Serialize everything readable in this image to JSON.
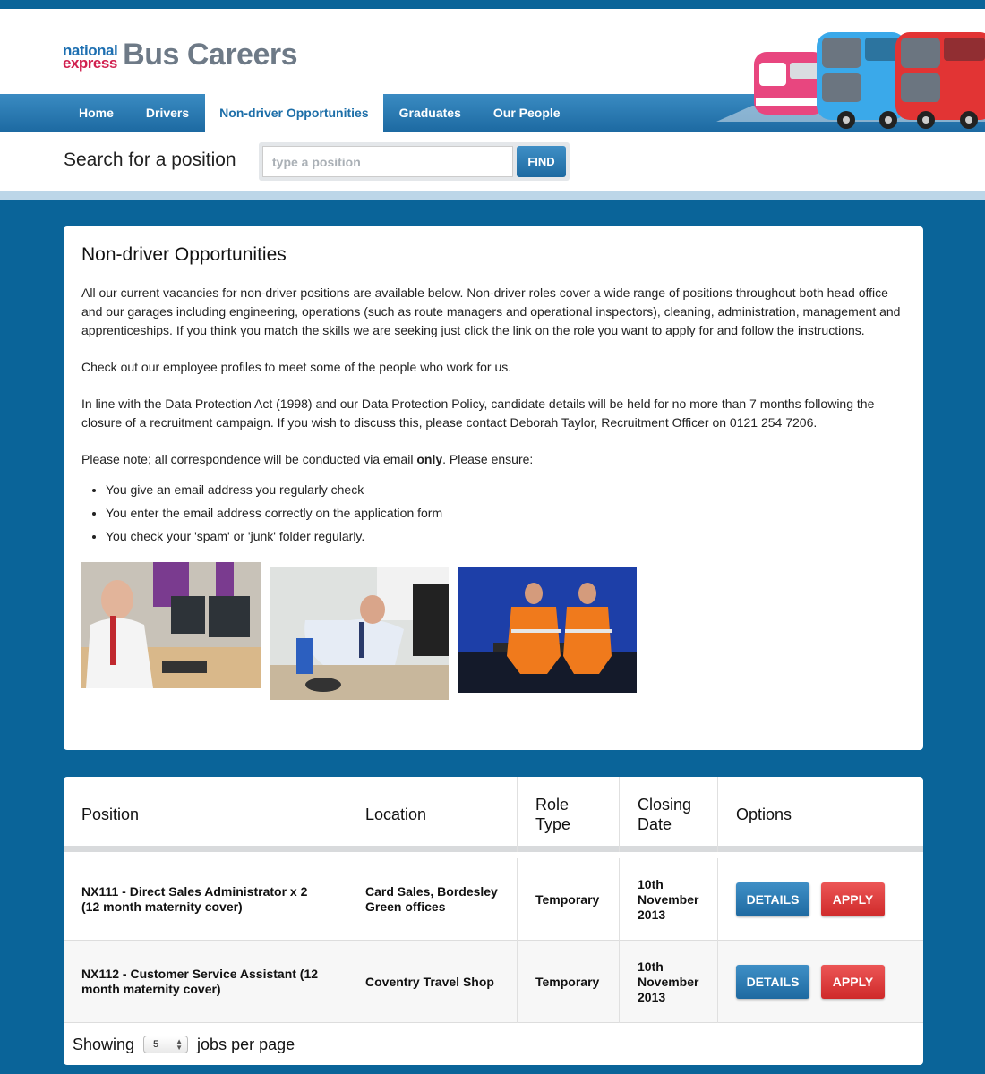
{
  "header": {
    "logo_line1": "national",
    "logo_line2": "express",
    "title": "Bus Careers"
  },
  "nav": {
    "items": [
      {
        "label": "Home"
      },
      {
        "label": "Drivers"
      },
      {
        "label": "Non-driver Opportunities",
        "active": true
      },
      {
        "label": "Graduates"
      },
      {
        "label": "Our People"
      }
    ]
  },
  "search": {
    "label": "Search for a position",
    "placeholder": "type a position",
    "value": "",
    "button": "FIND"
  },
  "intro": {
    "title": "Non-driver Opportunities",
    "para1": "All our current vacancies for non-driver positions are available below. Non-driver roles cover a wide range of positions throughout both head office and our garages including engineering, operations (such as route managers and operational inspectors), cleaning, administration, management and apprenticeships. If you think you match the skills we are seeking just click the link on the role you want to apply for and follow the instructions.",
    "para2": "Check out our employee profiles to meet some of the people who work for us.",
    "para3": "In line with the Data Protection Act (1998) and our Data Protection Policy, candidate details will be held for no more than 7 months following the closure of a recruitment campaign. If you wish to discuss this, please contact Deborah Taylor, Recruitment Officer on 0121 254 7206.",
    "para4_before": "Please note; all correspondence will be conducted via email ",
    "para4_bold": "only",
    "para4_after": ".  Please ensure:",
    "bullets": [
      "You give an email address you regularly check",
      "You enter the email address correctly on the application form",
      "You check your 'spam' or 'junk' folder regularly."
    ]
  },
  "table": {
    "headers": {
      "position": "Position",
      "location": "Location",
      "role_type_1": "Role",
      "role_type_2": "Type",
      "closing_1": "Closing",
      "closing_2": "Date",
      "options": "Options"
    },
    "rows": [
      {
        "position": "NX111 - Direct Sales Administrator x 2 (12 month maternity cover)",
        "location": "Card Sales, Bordesley Green offices",
        "role_type": "Temporary",
        "closing_date": "10th November 2013",
        "details": "DETAILS",
        "apply": "APPLY"
      },
      {
        "position": "NX112 - Customer Service Assistant (12 month maternity cover)",
        "location": "Coventry Travel Shop",
        "role_type": "Temporary",
        "closing_date": "10th November 2013",
        "details": "DETAILS",
        "apply": "APPLY"
      }
    ],
    "footer": {
      "showing": "Showing",
      "per_page_value": "5",
      "suffix": "jobs per page"
    }
  },
  "colors": {
    "background": "#0a6499",
    "nav": "#1d6aa2",
    "primary_button": "#1e6aa1",
    "apply_button": "#cf2a2a"
  }
}
